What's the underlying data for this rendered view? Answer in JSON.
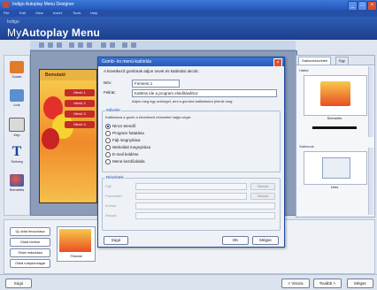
{
  "window": {
    "title": "Indigo Autoplay Menu Designer"
  },
  "menubar": [
    "File",
    "Edit",
    "View",
    "Insert",
    "Tools",
    "Help"
  ],
  "brand": {
    "small": "Indigo",
    "prefix": "My",
    "name": "Autoplay Menu"
  },
  "tools": [
    {
      "label": "Gomb",
      "color": "#e07b2a"
    },
    {
      "label": "Link",
      "color": "#5a8fd0"
    },
    {
      "label": "Kép",
      "color": "#d9d9d9"
    },
    {
      "label": "Szöveg",
      "color": "#1e3f9a"
    },
    {
      "label": "Kiemelés",
      "color": "#d13b2a"
    }
  ],
  "canvas": {
    "header": "Bemutató",
    "items": [
      "Menü 1",
      "Menü 2",
      "Menü 3",
      "Menü 4"
    ]
  },
  "right_panel": {
    "tabs": [
      "Sablonkészletek",
      "Egy"
    ],
    "sections": [
      "Háttér",
      "Sablonok"
    ],
    "thumb_labels": [
      "Kiemelés",
      "Üres"
    ]
  },
  "bottom_buttons": [
    "Új oldal beszúrása",
    "Oldal törlése",
    "Oldal másolása",
    "Oldal tulajdonságai"
  ],
  "bottom_thumb_label": "Főoldal",
  "footer": {
    "help": "Súgó",
    "back": "< Vissza",
    "next": "Tovább >",
    "close": "Mégse"
  },
  "dialog": {
    "title": "Gomb- és menü-kattintás",
    "subtitle": "A következő gombnak adjon nevet és kattintási akciót.",
    "name_label": "Név:",
    "name_value": "Fomenü 1",
    "caption_label": "Felirat:",
    "caption_value": "Kattints ide a program elindításához",
    "note": "Adjon meg egy szöveget, ami a gombra kattintáskor jelenik meg.",
    "group_action": "Művelet",
    "action_desc": "Kattintásra a gomb a következő műveletet hajtja végre:",
    "options": [
      "Nincs teendő",
      "Program futtatása",
      "Fájl megnyitása",
      "Weboldal megnyitása",
      "E-mail küldése",
      "Menü kezdőoldala"
    ],
    "selected": 0,
    "group_details": "Részletek",
    "detail_labels": [
      "Fájl:",
      "Paraméter:",
      "Indítás:",
      "Mappa:"
    ],
    "browse": "Tallózás",
    "help_btn": "Súgó",
    "ok_btn": "OK",
    "cancel_btn": "Mégse"
  }
}
